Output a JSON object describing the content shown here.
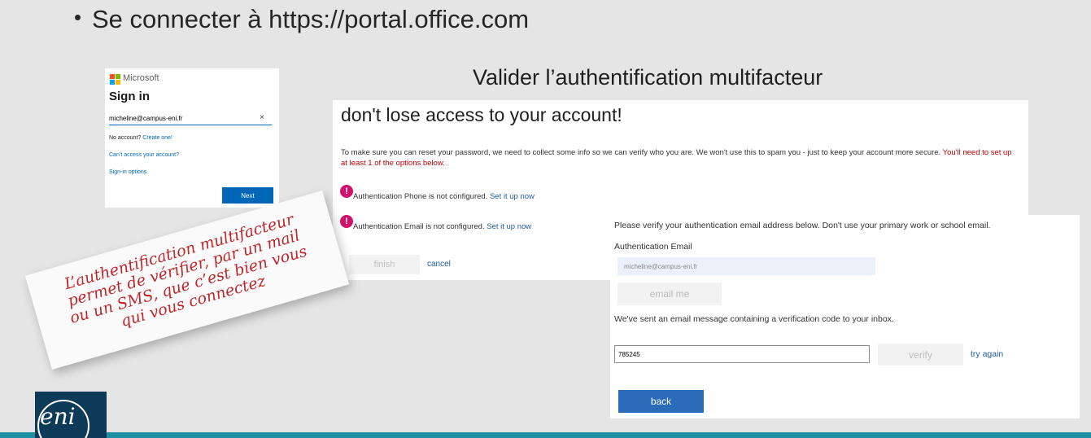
{
  "slide": {
    "bullet": "Se connecter à https://portal.office.com",
    "mfa_heading": "Valider l’authentification multifacteur"
  },
  "signin": {
    "brand": "Microsoft",
    "title": "Sign in",
    "email_value": "micheline@campus-eni.fr",
    "clear_icon": "×",
    "no_account_text": "No account?",
    "create_link": "Create one!",
    "cant_access_link": "Can’t access your account?",
    "signin_options_link": "Sign-in options",
    "next_button": "Next",
    "logo_colors": [
      "#f25022",
      "#7fba00",
      "#00a4ef",
      "#ffb900"
    ]
  },
  "access": {
    "title": "don't lose access to your account!",
    "description": "To make sure you can reset your password, we need to collect some info so we can verify who you are. We won't use this to spam you - just to keep your account more secure.",
    "description_required": "You'll need to set up at least 1 of the options below.",
    "phone_status": "Authentication Phone is not configured.",
    "email_status": "Authentication Email is not configured.",
    "set_up_link": "Set it up now",
    "finish_button": "finish",
    "cancel_link": "cancel",
    "warning_icon": "!"
  },
  "verify": {
    "instructions": "Please verify your authentication email address below. Don't use your primary work or school email.",
    "email_label": "Authentication Email",
    "email_value": "micheline@campus-eni.fr",
    "email_me_button": "email me",
    "sent_message": "We've sent an email message containing a verification code to your inbox.",
    "code_value": "785245",
    "verify_button": "verify",
    "try_again_link": "try again",
    "back_button": "back"
  },
  "note": {
    "line1": "L’authentification multifacteur",
    "line2": "permet de vérifier, par un mail",
    "line3": "ou un SMS, que c’est bien vous",
    "line4": "qui vous connectez"
  },
  "logo": {
    "text": "eni"
  },
  "colors": {
    "accent_bar": "#1f8fa3",
    "ms_blue": "#0067b8",
    "warning_magenta": "#d1126d",
    "note_text": "#c0272d"
  }
}
